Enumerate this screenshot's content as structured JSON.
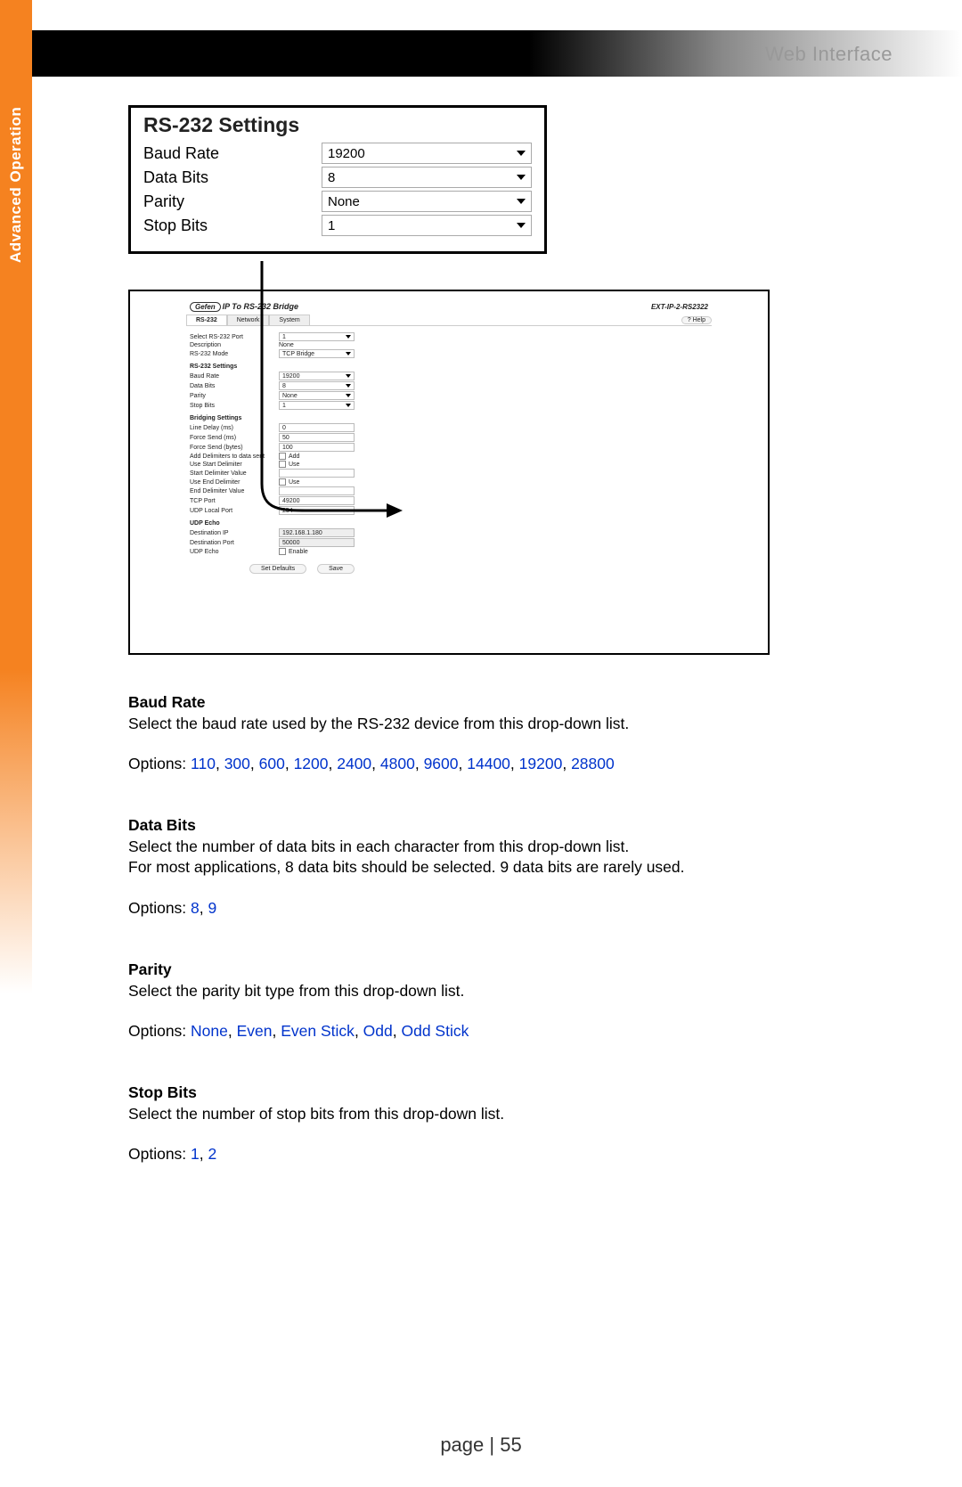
{
  "header": {
    "title": "Web Interface"
  },
  "sidebar": {
    "label": "Advanced Operation"
  },
  "settings_box": {
    "title": "RS-232 Settings",
    "rows": [
      {
        "label": "Baud Rate",
        "value": "19200"
      },
      {
        "label": "Data Bits",
        "value": "8"
      },
      {
        "label": "Parity",
        "value": "None"
      },
      {
        "label": "Stop Bits",
        "value": "1"
      }
    ]
  },
  "detail_panel": {
    "logo": "Gefen",
    "title": "IP To RS-232 Bridge",
    "model": "EXT-IP-2-RS2322",
    "tabs": [
      "RS-232",
      "Network",
      "System"
    ],
    "help": "? Help",
    "top_rows": [
      {
        "label": "Select RS-232 Port",
        "value": "1",
        "type": "dd"
      },
      {
        "label": "Description",
        "value": "None",
        "type": "txt"
      },
      {
        "label": "RS-232 Mode",
        "value": "TCP Bridge",
        "type": "dd"
      }
    ],
    "rs232_title": "RS-232 Settings",
    "rs232_rows": [
      {
        "label": "Baud Rate",
        "value": "19200"
      },
      {
        "label": "Data Bits",
        "value": "8"
      },
      {
        "label": "Parity",
        "value": "None"
      },
      {
        "label": "Stop Bits",
        "value": "1"
      }
    ],
    "bridging_title": "Bridging Settings",
    "bridging_rows": [
      {
        "label": "Line Delay (ms)",
        "value": "0",
        "type": "in"
      },
      {
        "label": "Force Send (ms)",
        "value": "50",
        "type": "in"
      },
      {
        "label": "Force Send (bytes)",
        "value": "100",
        "type": "in"
      },
      {
        "label": "Add Delimiters to data sent",
        "value": "Add",
        "type": "chk"
      },
      {
        "label": "Use Start Delimiter",
        "value": "Use",
        "type": "chk"
      },
      {
        "label": "Start Delimiter Value",
        "value": "",
        "type": "in"
      },
      {
        "label": "Use End Delimiter",
        "value": "Use",
        "type": "chk"
      },
      {
        "label": "End Delimiter Value",
        "value": "",
        "type": "in"
      },
      {
        "label": "TCP Port",
        "value": "49200",
        "type": "in"
      },
      {
        "label": "UDP Local Port",
        "value": "254",
        "type": "in"
      }
    ],
    "udp_title": "UDP Echo",
    "udp_rows": [
      {
        "label": "Destination IP",
        "value": "192.168.1.180",
        "type": "ro"
      },
      {
        "label": "Destination Port",
        "value": "50000",
        "type": "ro"
      },
      {
        "label": "UDP Echo",
        "value": "Enable",
        "type": "chk"
      }
    ],
    "buttons": [
      "Set Defaults",
      "Save"
    ]
  },
  "descriptions": [
    {
      "heading": "Baud Rate",
      "body": "Select the baud rate used by the RS-232 device from this drop-down list.",
      "options_prefix": "Options:",
      "options": [
        "110",
        "300",
        "600",
        "1200",
        "2400",
        "4800",
        "9600",
        "14400",
        "19200",
        "28800"
      ]
    },
    {
      "heading": "Data Bits",
      "body": "Select the number of data bits in each character from this drop-down list.\nFor most applications, 8 data bits should be selected.  9 data bits are rarely used.",
      "options_prefix": "Options:",
      "options": [
        "8",
        "9"
      ]
    },
    {
      "heading": "Parity",
      "body": "Select the parity bit type from this drop-down list.",
      "options_prefix": "Options:",
      "options": [
        "None",
        "Even",
        "Even Stick",
        "Odd",
        "Odd Stick"
      ]
    },
    {
      "heading": "Stop Bits",
      "body": "Select the number of stop bits from this drop-down list.",
      "options_prefix": "Options:",
      "options": [
        "1",
        "2"
      ]
    }
  ],
  "footer": {
    "prefix": "page | ",
    "num": "55"
  }
}
